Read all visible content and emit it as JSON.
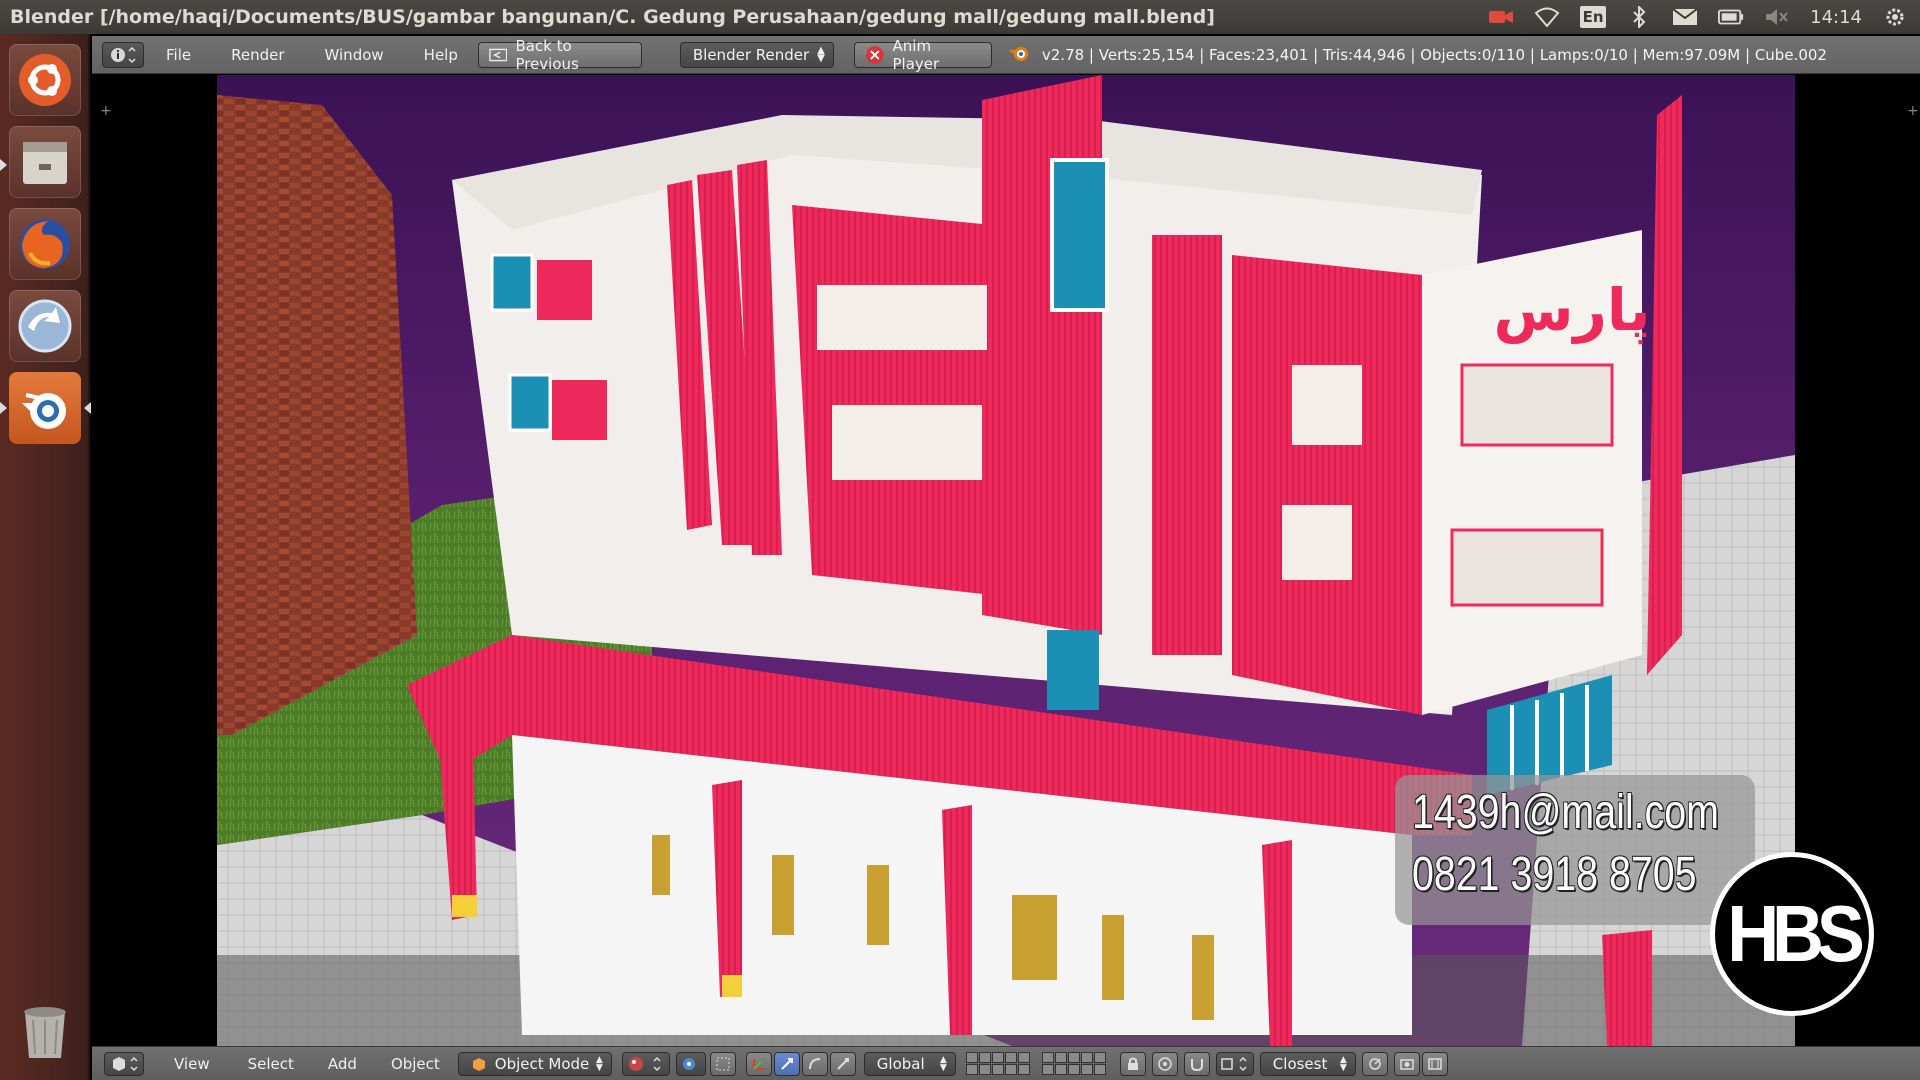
{
  "window": {
    "title": "Blender [/home/haqi/Documents/BUS/gambar bangunan/C. Gedung Perusahaan/gedung mall/gedung mall.blend]",
    "clock": "14:14",
    "keyboard_layout": "En"
  },
  "launcher": {
    "items": [
      {
        "icon": "ubuntu-dash-icon"
      },
      {
        "icon": "files-icon"
      },
      {
        "icon": "firefox-icon"
      },
      {
        "icon": "software-updater-icon"
      },
      {
        "icon": "blender-icon",
        "active": true
      },
      {
        "icon": "trash-icon"
      }
    ]
  },
  "info_header": {
    "menus": [
      "File",
      "Render",
      "Window",
      "Help"
    ],
    "back_button": "Back to Previous",
    "render_engine": "Blender Render",
    "anim_player": "Anim Player",
    "stats": "v2.78 | Verts:25,154 | Faces:23,401 | Tris:44,946 | Objects:0/110 | Lamps:0/10 | Mem:97.09M | Cube.002"
  },
  "viewport": {
    "sign_text": "پارس",
    "overlay": {
      "email": "1439h@mail.com",
      "phone": "0821 3918 8705",
      "logo": "HBS"
    }
  },
  "view_header": {
    "menus": [
      "View",
      "Select",
      "Add",
      "Object"
    ],
    "mode": "Object Mode",
    "orientation": "Global",
    "snap_target": "Closest"
  },
  "colors": {
    "building_red": "#ee2a5c",
    "building_white": "#f4f1ee",
    "window_teal": "#1c8fb4",
    "sky_purple": "#5a1f6a",
    "grass": "#4f7a2a",
    "blender_header": "#6a6a6a"
  }
}
